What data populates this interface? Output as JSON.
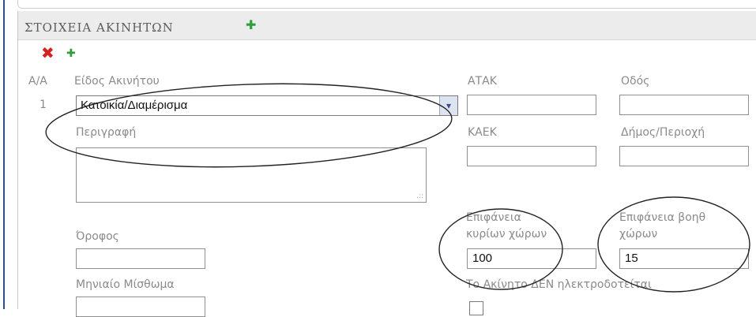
{
  "section": {
    "title": "ΣΤΟΙΧΕΙΑ ΑΚΙΝΗΤΩΝ"
  },
  "row": {
    "index_label": "Α/Α",
    "index_value": "1",
    "property_type_label": "Είδος Ακινήτου",
    "property_type_value": "Κατοικία/Διαμέρισμα",
    "atak_label": "ΑΤΑΚ",
    "street_label": "Οδός",
    "description_label": "Περιγραφή",
    "kaek_label": "ΚΑΕΚ",
    "municipality_label": "Δήμος/Περιοχή",
    "floor_label": "Όροφος",
    "main_area_label_line1": "Επιφάνεια",
    "main_area_label_line2": "κυρίων χώρων",
    "main_area_value": "100",
    "aux_area_label_line1": "Επιφάνεια βοηθ",
    "aux_area_label_line2": "χώρων",
    "aux_area_value": "15",
    "monthly_rent_label": "Μηνιαίο Μίσθωμα",
    "no_electricity_label": "Το Ακίνητο ΔΕΝ ηλεκτροδοτείται"
  },
  "icons": {
    "add_section": "plus-icon",
    "delete_row": "close-icon",
    "add_row": "plus-icon",
    "dropdown": "chevron-down-icon"
  },
  "colors": {
    "add": "#2f9e3a",
    "delete": "#d42222",
    "header_bg": "#ececec",
    "dropdown_button": "#dde3f0"
  }
}
